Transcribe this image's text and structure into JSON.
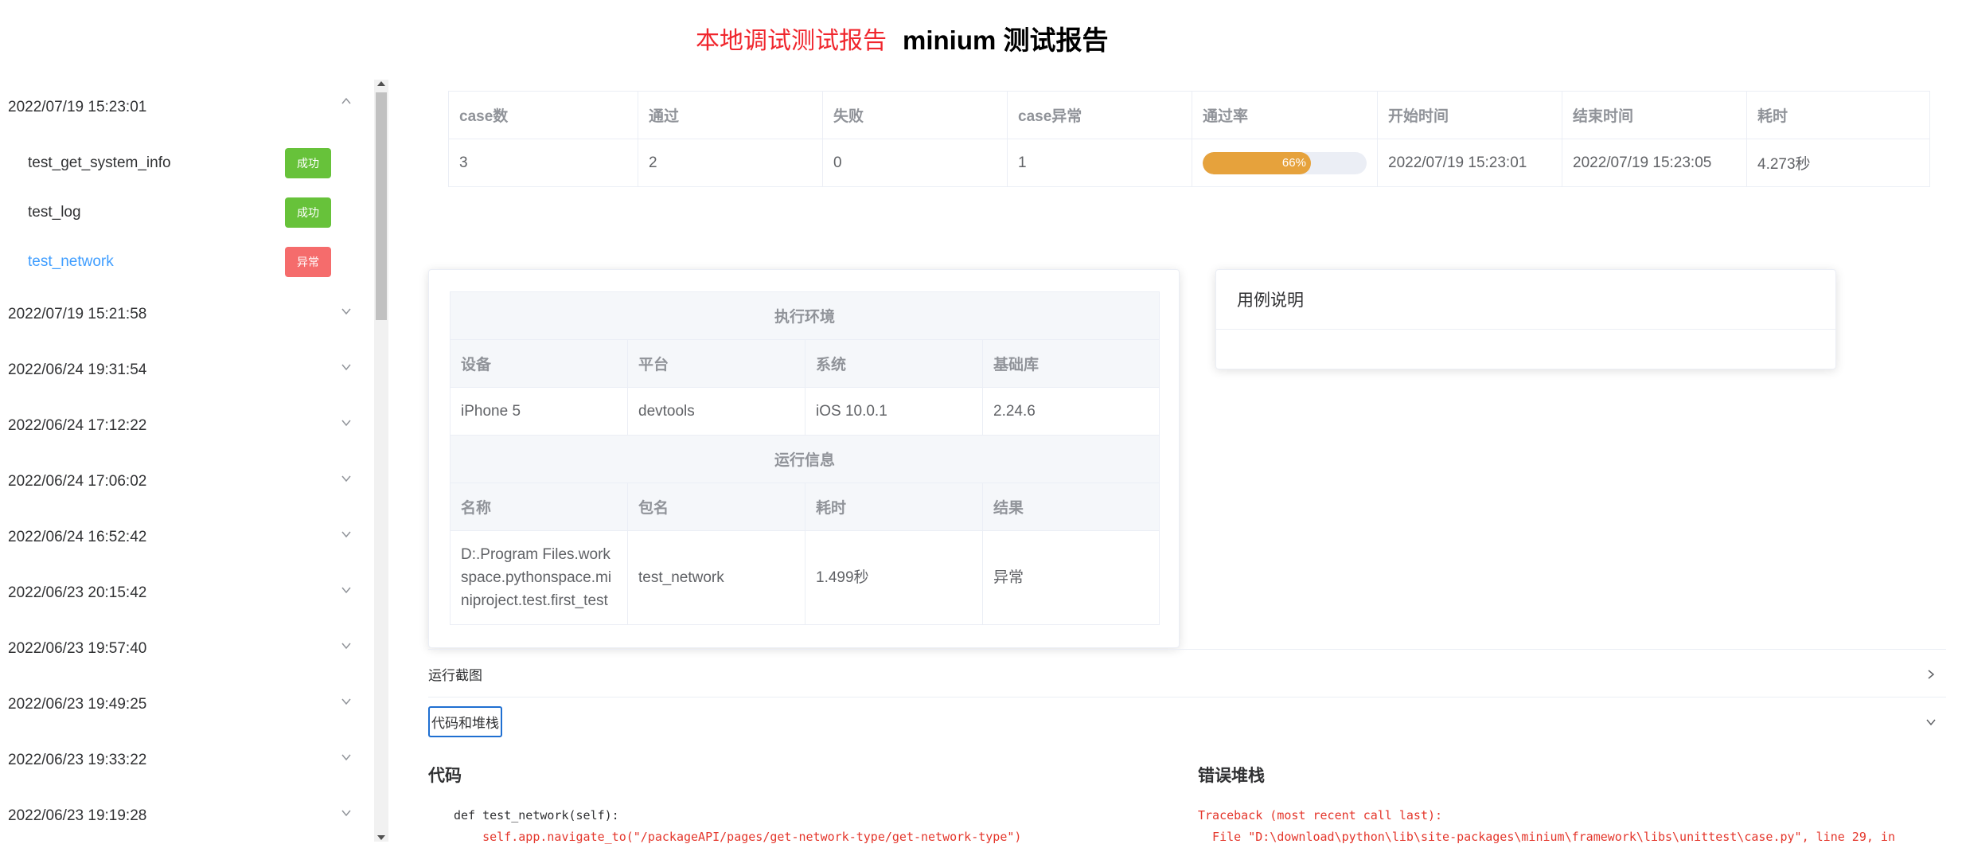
{
  "header": {
    "local_link": "本地调试测试报告",
    "title": "minium 测试报告"
  },
  "sidebar": {
    "groups": [
      {
        "time": "2022/07/19 15:23:01",
        "expanded": true,
        "cases": [
          {
            "name": "test_get_system_info",
            "status": "成功"
          },
          {
            "name": "test_log",
            "status": "成功"
          },
          {
            "name": "test_network",
            "status": "异常"
          }
        ]
      },
      {
        "time": "2022/07/19 15:21:58"
      },
      {
        "time": "2022/06/24 19:31:54"
      },
      {
        "time": "2022/06/24 17:12:22"
      },
      {
        "time": "2022/06/24 17:06:02"
      },
      {
        "time": "2022/06/24 16:52:42"
      },
      {
        "time": "2022/06/23 20:15:42"
      },
      {
        "time": "2022/06/23 19:57:40"
      },
      {
        "time": "2022/06/23 19:49:25"
      },
      {
        "time": "2022/06/23 19:33:22"
      },
      {
        "time": "2022/06/23 19:19:28"
      }
    ]
  },
  "summary": {
    "headers": [
      "case数",
      "通过",
      "失败",
      "case异常",
      "通过率",
      "开始时间",
      "结束时间",
      "耗时"
    ],
    "values": {
      "cases": "3",
      "passed": "2",
      "failed": "0",
      "errors": "1",
      "pass_rate_text": "66%",
      "pass_rate": 0.66,
      "start": "2022/07/19 15:23:01",
      "end": "2022/07/19 15:23:05",
      "duration": "4.273秒"
    }
  },
  "env": {
    "section_title": "执行环境",
    "headers": [
      "设备",
      "平台",
      "系统",
      "基础库"
    ],
    "values": [
      "iPhone 5",
      "devtools",
      "iOS 10.0.1",
      "2.24.6"
    ]
  },
  "run": {
    "section_title": "运行信息",
    "headers": [
      "名称",
      "包名",
      "耗时",
      "结果"
    ],
    "values": [
      "D:.Program Files.workspace.pythonspace.miniproject.test.first_test",
      "test_network",
      "1.499秒",
      "异常"
    ]
  },
  "description": {
    "title": "用例说明"
  },
  "sections": {
    "screenshots": "运行截图",
    "code_stack": "代码和堆栈"
  },
  "code": {
    "heading": "代码",
    "lines": [
      "def test_network(self):",
      "    self.app.navigate_to(\"/packageAPI/pages/get-network-type/get-network-type\")"
    ]
  },
  "stack": {
    "heading": "错误堆栈",
    "lines": [
      "Traceback (most recent call last):",
      "  File \"D:\\download\\python\\lib\\site-packages\\minium\\framework\\libs\\unittest\\case.py\", line 29, in"
    ]
  },
  "colors": {
    "success": "#67c23a",
    "error": "#f56c6c",
    "progress": "#e6a23c",
    "link": "#409eff",
    "red_title": "#f0262d",
    "code_red": "#e4362b"
  }
}
